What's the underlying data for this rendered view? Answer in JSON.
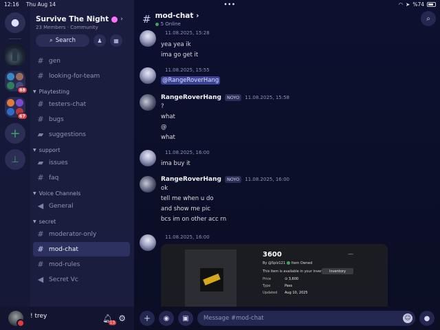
{
  "status": {
    "time": "12:16",
    "date": "Thu Aug 14",
    "battery": "%74"
  },
  "rail": {
    "badges": [
      "88",
      "67"
    ]
  },
  "guild": {
    "name": "Survive The Night",
    "members": "23 Members",
    "separator": "·",
    "type": "Community",
    "search_label": "Search"
  },
  "channels": {
    "top": [
      "gen",
      "looking-for-team"
    ],
    "categories": [
      {
        "name": "Playtesting",
        "items": [
          "testers-chat",
          "bugs",
          "suggestions"
        ]
      },
      {
        "name": "support",
        "items": [
          "issues",
          "faq"
        ]
      },
      {
        "name": "Voice Channels",
        "items": [
          "General"
        ]
      },
      {
        "name": "secret",
        "items": [
          "moderator-only",
          "mod-chat",
          "mod-rules",
          "Secret Vc"
        ]
      }
    ]
  },
  "user": {
    "name": "! trey",
    "notif_count": "13"
  },
  "chat": {
    "title": "mod-chat",
    "online": "5 Online",
    "placeholder": "Message #mod-chat",
    "messages": [
      {
        "time": "11.08.2025, 15:28",
        "lines": [
          "yea yea ik",
          "ima go get it"
        ]
      },
      {
        "time": "11.08.2025, 15:55",
        "lines": [
          "@RangeRoverHang"
        ]
      },
      {
        "author": "RangeRoverHang",
        "tag": "NOYO",
        "time": "11.08.2025, 15:58",
        "lines": [
          "?",
          "what",
          "@",
          "what"
        ]
      },
      {
        "time": "11.08.2025, 16:00",
        "lines": [
          "ima buy it"
        ]
      },
      {
        "author": "RangeRoverHang",
        "tag": "NOYO",
        "time": "11.08.2025, 16:00",
        "lines": [
          "ok",
          "tell me when u do",
          "and show me pic",
          "bcs im on other acc rn"
        ]
      },
      {
        "time": "11.08.2025, 16:00",
        "lines": []
      }
    ],
    "embed": {
      "title": "3600",
      "dash": "—",
      "by": "By @5plz121",
      "owned": "Item Owned",
      "available": "This item is available in your inventory.",
      "inventory_btn": "Inventory",
      "price_label": "Price",
      "price_value": "⊙ 3,600",
      "type_label": "Type",
      "type_value": "Pass",
      "updated_label": "Updated",
      "updated_value": "Aug 10, 2025"
    }
  }
}
